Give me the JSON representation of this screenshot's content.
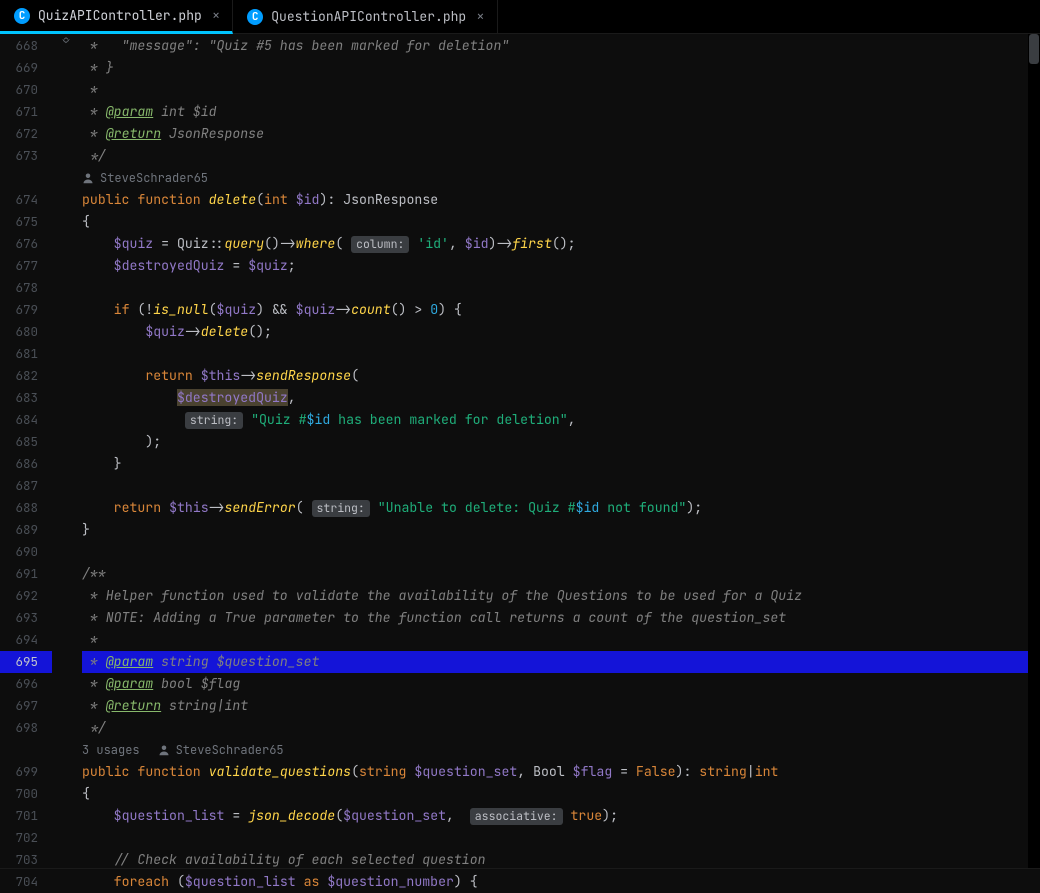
{
  "tabs": [
    {
      "label": "QuizAPIController.php",
      "icon": "C",
      "active": true
    },
    {
      "label": "QuestionAPIController.php",
      "icon": "C",
      "active": false
    }
  ],
  "annot": {
    "author1": "SteveSchrader65",
    "usages2": "3 usages",
    "author2": "SteveSchrader65"
  },
  "gutter": {
    "start": 668,
    "end": 704,
    "current": 695
  },
  "hints": {
    "column": "column:",
    "string": "string:",
    "assoc": "associative:"
  },
  "code": {
    "l668": " *   \"message\": \"Quiz #5 has been marked for deletion\"",
    "l669_a": " * }",
    "l670_a": " *",
    "l671_a": " * ",
    "l671_tag": "@param",
    "l671_rest": " int $id",
    "l672_a": " * ",
    "l672_tag": "@return",
    "l672_rest": " JsonResponse",
    "l673_a": " */",
    "l674_pub": "public",
    "l674_fun": "function",
    "l674_name": "delete",
    "l674_sig_a": "(",
    "l674_int": "int",
    "l674_var": "$id",
    "l674_sig_b": "): JsonResponse",
    "l675": "{",
    "l676_var": "$quiz",
    "l676_eq": " = ",
    "l676_cls": "Quiz",
    "l676_scope": "::",
    "l676_q": "query",
    "l676_p1": "()->",
    "l676_where": "where",
    "l676_op": "(",
    "l676_hint": "column",
    "l676_str": "'id'",
    "l676_c": ", ",
    "l676_id": "$id",
    "l676_tail": ")->",
    "l676_first": "first",
    "l676_end": "();",
    "l677_var": "$destroyedQuiz",
    "l677_rest": " = ",
    "l677_quiz": "$quiz",
    "l677_sc": ";",
    "l678": "",
    "l679_if": "if",
    "l679_a": " (!",
    "l679_isnull": "is_null",
    "l679_b": "(",
    "l679_quiz": "$quiz",
    "l679_c": ") && ",
    "l679_quiz2": "$quiz",
    "l679_arr": "->",
    "l679_count": "count",
    "l679_d": "() > ",
    "l679_zero": "0",
    "l679_e": ") {",
    "l680_quiz": "$quiz",
    "l680_arr": "->",
    "l680_del": "delete",
    "l680_end": "();",
    "l681": "",
    "l682_ret": "return",
    "l682_sp": " ",
    "l682_this": "$this",
    "l682_arr": "->",
    "l682_send": "sendResponse",
    "l682_end": "(",
    "l683_var": "$destroyedQuiz",
    "l683_c": ",",
    "l684_hint": "string",
    "l684_s1": "\"Quiz #",
    "l684_v": "$id",
    "l684_s2": " has been marked for deletion\"",
    "l684_c": ",",
    "l685": ");",
    "l686": "}",
    "l687": "",
    "l688_ret": "return",
    "l688_sp": " ",
    "l688_this": "$this",
    "l688_arr": "->",
    "l688_err": "sendError",
    "l688_op": "(",
    "l688_hint": "string",
    "l688_s1": "\"Unable to delete: Quiz #",
    "l688_v": "$id",
    "l688_s2": " not found\"",
    "l688_end": ");",
    "l689": "}",
    "l690": "",
    "l691": "/**",
    "l692": " * Helper function used to validate the availability of the Questions to be used for a Quiz",
    "l693": " * NOTE: Adding a True parameter to the function call returns a count of the question_set",
    "l694": " *",
    "l695_a": " * ",
    "l695_tag": "@param",
    "l695_rest": " string $question_set",
    "l696_a": " * ",
    "l696_tag": "@param",
    "l696_rest": " bool $flag",
    "l697_a": " * ",
    "l697_tag": "@return",
    "l697_rest": " string|int",
    "l698": " */",
    "l699_pub": "public",
    "l699_fun": "function",
    "l699_name": "validate_questions",
    "l699_a": "(",
    "l699_str": "string",
    "l699_v1": "$question_set",
    "l699_c1": ", Bool ",
    "l699_v2": "$flag",
    "l699_eq": " = ",
    "l699_false": "False",
    "l699_b": "): ",
    "l699_ret": "string",
    "l699_pipe": "|",
    "l699_int": "int",
    "l700": "{",
    "l701_v": "$question_list",
    "l701_eq": " = ",
    "l701_jd": "json_decode",
    "l701_a": "(",
    "l701_qs": "$question_set",
    "l701_c": ", ",
    "l701_hint": "assoc",
    "l701_true": "true",
    "l701_end": ");",
    "l702": "",
    "l703": "// Check availability of each selected question",
    "l704_fe": "foreach",
    "l704_a": " (",
    "l704_ql": "$question_list",
    "l704_as": " as ",
    "l704_qn": "$question_number",
    "l704_b": ") {"
  },
  "status": ""
}
